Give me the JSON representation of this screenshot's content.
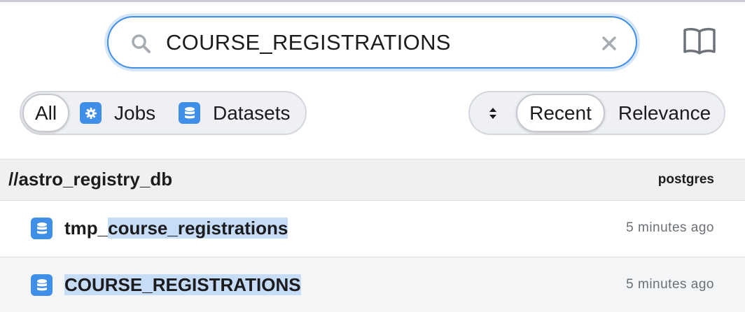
{
  "search": {
    "value": "COURSE_REGISTRATIONS",
    "icon": "search-icon",
    "clear_icon": "close-icon"
  },
  "toolbar": {
    "docs_icon": "book-icon"
  },
  "filters": {
    "all_label": "All",
    "jobs_label": "Jobs",
    "datasets_label": "Datasets",
    "jobs_icon": "gear-icon",
    "datasets_icon": "database-icon"
  },
  "sort": {
    "toggle_icon": "sort-arrows-icon",
    "recent_label": "Recent",
    "relevance_label": "Relevance"
  },
  "results": {
    "group": {
      "title": "//astro_registry_db",
      "source": "postgres"
    },
    "rows": [
      {
        "name_prefix": "tmp_",
        "name_match": "course_registrations",
        "time": "5 minutes ago",
        "icon": "database-icon"
      },
      {
        "name_prefix": "",
        "name_match": "COURSE_REGISTRATIONS",
        "time": "5 minutes ago",
        "icon": "database-icon"
      }
    ]
  },
  "colors": {
    "accent": "#3f8ee8",
    "highlight": "#c7dcf6"
  }
}
